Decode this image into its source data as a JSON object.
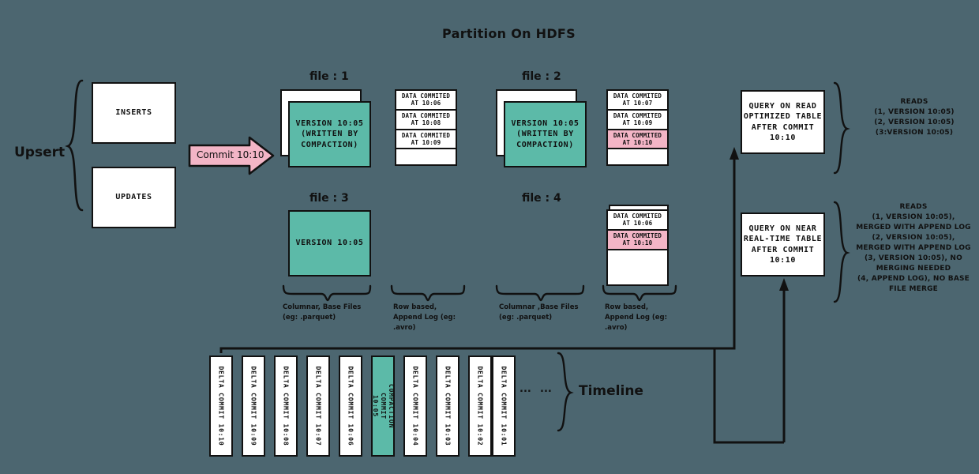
{
  "title": "Partition On HDFS",
  "colors": {
    "background": "#4c6670",
    "teal": "#5cbaa8",
    "pink": "#f3b5c6",
    "ink": "#111111",
    "paper": "#ffffff"
  },
  "upsert": {
    "label": "Upsert",
    "inserts": "INSERTS",
    "updates": "UPDATES"
  },
  "commit_arrow": {
    "label": "Commit 10:10"
  },
  "files": [
    {
      "header": "file : 1",
      "base": {
        "text": "VERSION 10:05\n(WRITTEN BY\nCOMPACTION)",
        "color": "teal",
        "stacked": true
      },
      "log_rows": [
        {
          "text": "DATA COMMITED\nAT 10:06",
          "highlight": false
        },
        {
          "text": "DATA COMMITED\nAT 10:08",
          "highlight": false
        },
        {
          "text": "DATA COMMITED\nAT 10:09",
          "highlight": false
        }
      ],
      "base_caption": "Columnar, Base Files\n(eg: .parquet)",
      "log_caption": "Row based,\nAppend Log  (eg:\n.avro)"
    },
    {
      "header": "file : 2",
      "base": {
        "text": "VERSION 10:05\n(WRITTEN BY\nCOMPACTION)",
        "color": "teal",
        "stacked": true
      },
      "log_rows": [
        {
          "text": "DATA COMMITED\nAT 10:07",
          "highlight": false
        },
        {
          "text": "DATA COMMITED\nAT 10:09",
          "highlight": false
        },
        {
          "text": "DATA COMMITED\nAT 10:10",
          "highlight": true
        }
      ],
      "base_caption": "Columnar ,Base Files\n(eg: .parquet)",
      "log_caption": "Row based,\nAppend Log  (eg:\n.avro)"
    },
    {
      "header": "file : 3",
      "base": {
        "text": "VERSION 10:05",
        "color": "teal",
        "stacked": false
      },
      "log_rows": [],
      "base_caption": "",
      "log_caption": ""
    },
    {
      "header": "file : 4",
      "base": null,
      "log_rows": [
        {
          "text": "DATA COMMITED\nAT 10:06",
          "highlight": false
        },
        {
          "text": "DATA COMMITED\nAT 10:10",
          "highlight": true
        }
      ],
      "base_caption": "",
      "log_caption": ""
    }
  ],
  "queries": [
    {
      "box": "QUERY ON READ\nOPTIMIZED TABLE\nAFTER COMMIT\n10:10",
      "reads": "READS\n(1, VERSION 10:05)\n(2, VERSION 10:05)\n(3:VERSION 10:05)"
    },
    {
      "box": "QUERY ON NEAR\nREAL-TIME TABLE\nAFTER COMMIT\n10:10",
      "reads": "READS\n(1, VERSION 10:05),\nMERGED WITH APPEND LOG\n(2, VERSION 10:05),\nMERGED WITH APPEND LOG\n(3, VERSION 10:05), NO\nMERGING NEEDED\n(4, APPEND LOG), NO BASE\nFILE MERGE"
    }
  ],
  "timeline": {
    "label": "Timeline",
    "ellipsis": "...",
    "cells": [
      {
        "text": "DELTA COMMIT  10:10",
        "highlight": false
      },
      {
        "text": "DELTA COMMIT  10:09",
        "highlight": false
      },
      {
        "text": "DELTA COMMIT  10:08",
        "highlight": false
      },
      {
        "text": "DELTA COMMIT  10:07",
        "highlight": false
      },
      {
        "text": "DELTA COMMIT  10:06",
        "highlight": false
      },
      {
        "text": "COMPACTION COMMIT 10:05",
        "highlight": true
      },
      {
        "text": "DELTA COMMIT  10:04",
        "highlight": false
      },
      {
        "text": "DELTA COMMIT  10:03",
        "highlight": false
      },
      {
        "text": "DELTA COMMIT  10:02",
        "highlight": false
      },
      {
        "text": "DELTA COMMIT  10:01",
        "highlight": false
      }
    ]
  }
}
